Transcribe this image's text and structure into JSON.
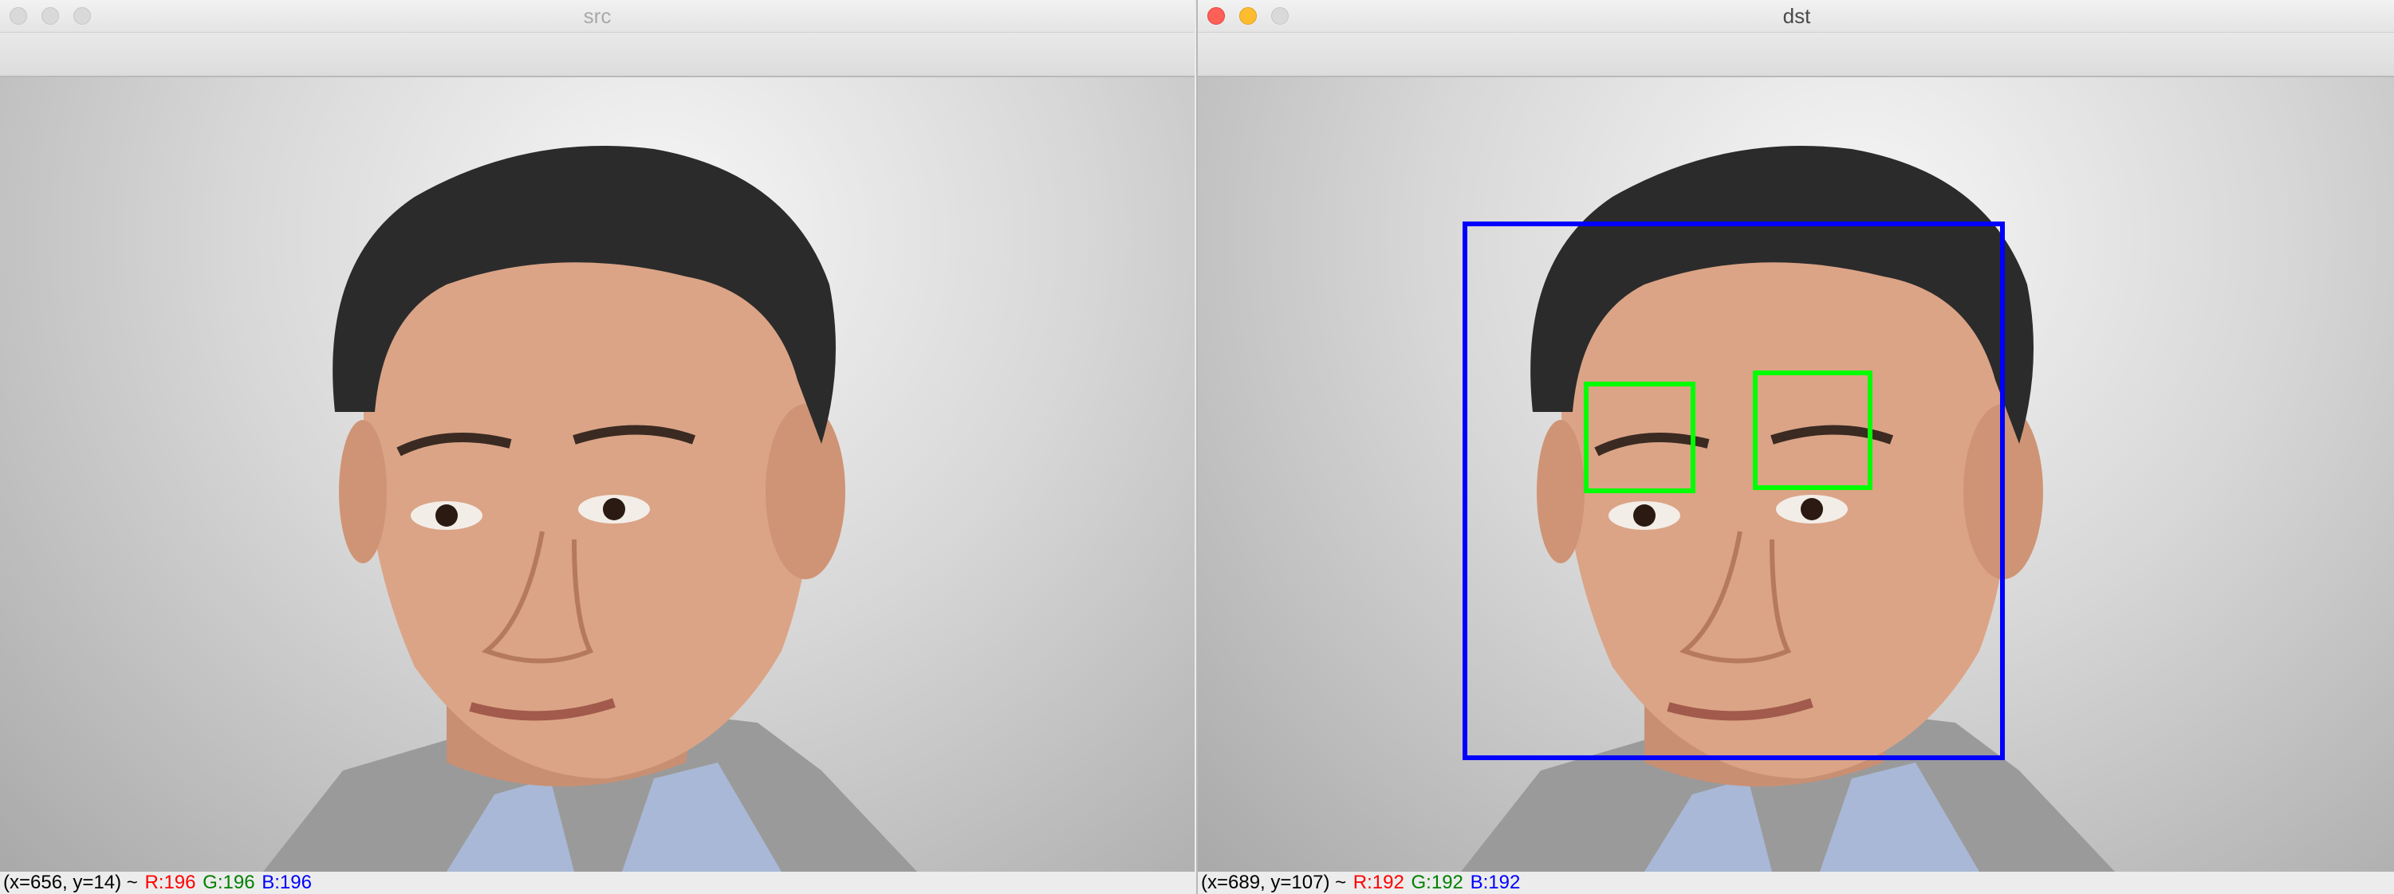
{
  "windows": {
    "src": {
      "title": "src",
      "status": {
        "coords": "(x=656, y=14) ~",
        "r": "R:196",
        "g": "G:196",
        "b": "B:196"
      }
    },
    "dst": {
      "title": "dst",
      "status": {
        "coords": "(x=689, y=107) ~",
        "r": "R:192",
        "g": "G:192",
        "b": "B:192"
      },
      "detections": {
        "face_color": "#0000ff",
        "eye_color": "#00ff00"
      }
    }
  },
  "colors": {
    "status_r": "#ff0000",
    "status_g": "#008000",
    "status_b": "#0000ff"
  },
  "icons": [
    "close-icon",
    "minimize-icon",
    "zoom-icon"
  ]
}
